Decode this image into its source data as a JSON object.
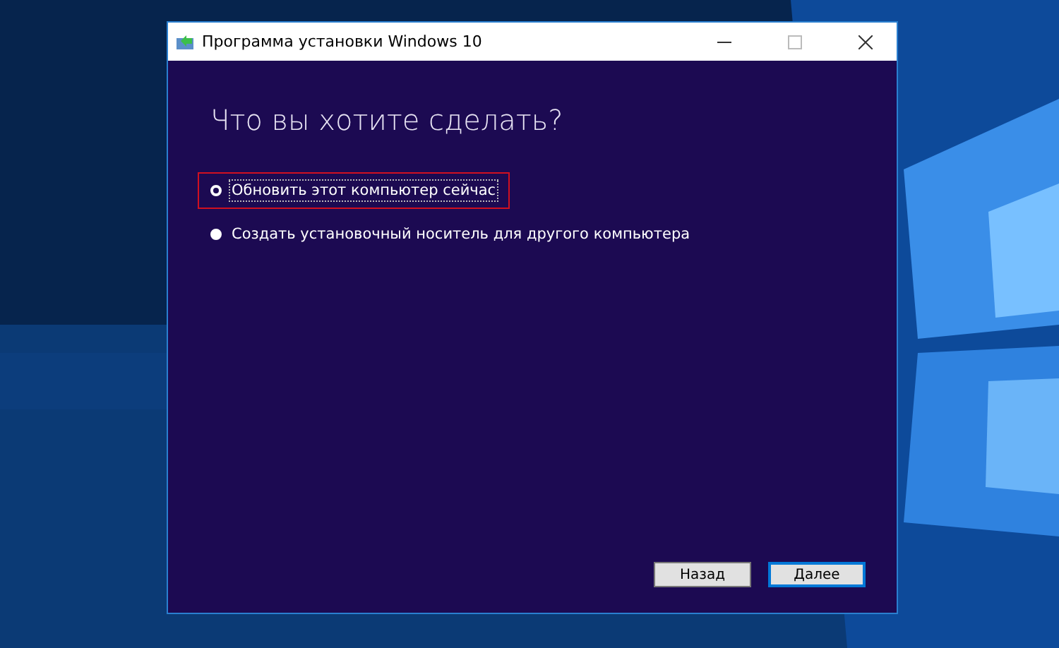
{
  "window": {
    "title": "Программа установки Windows 10"
  },
  "heading": "Что вы хотите сделать?",
  "options": [
    {
      "label": "Обновить этот компьютер сейчас",
      "selected": true,
      "highlighted": true
    },
    {
      "label": "Создать установочный носитель для другого компьютера",
      "selected": false,
      "highlighted": false
    }
  ],
  "buttons": [
    {
      "label": "Назад",
      "kind": "secondary"
    },
    {
      "label": "Далее",
      "kind": "primary"
    }
  ]
}
